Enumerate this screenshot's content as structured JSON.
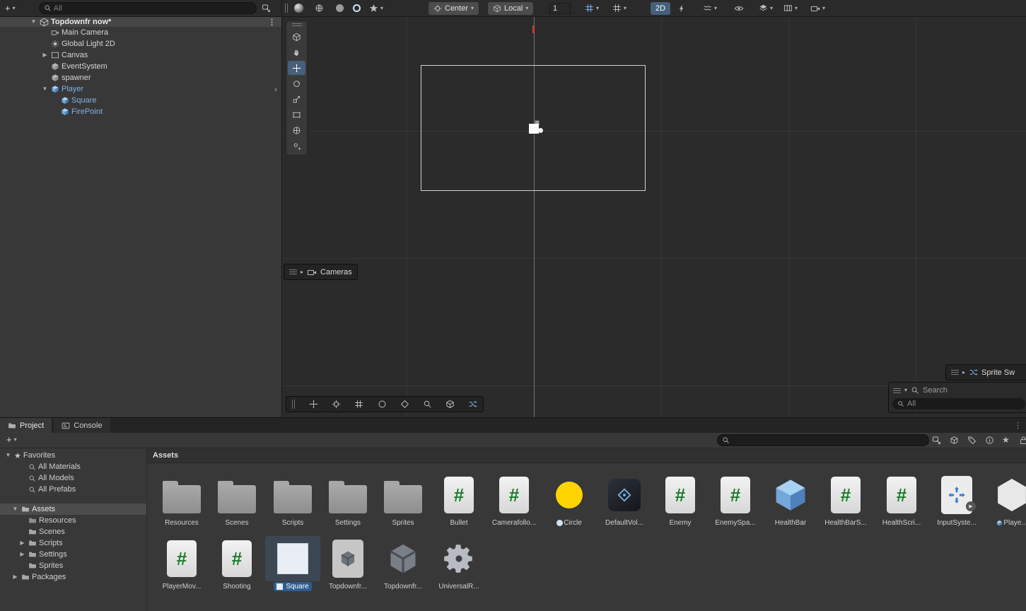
{
  "colors": {
    "selection_blue": "#2d5c8f",
    "prefab_text_blue": "#7fb2e5",
    "circle_sprite_yellow": "#ffd400",
    "active_toggle_blue": "#46607c",
    "panel_bg": "#383838",
    "scene_bg": "#2b2b2b"
  },
  "icons": {
    "caret_down": "▾",
    "foldout_open": "▼",
    "foldout_closed": "▶",
    "expand_right": "▸",
    "more_vertical": "⋮",
    "chevron_right": "›",
    "star": "★",
    "csharp_hash": "#"
  },
  "hierarchy": {
    "toolbar": {
      "add": "+",
      "search_placeholder": "All"
    },
    "scene_label": "Topdownfr now*",
    "items": [
      {
        "label": "Main Camera"
      },
      {
        "label": "Global Light 2D"
      },
      {
        "label": "Canvas"
      },
      {
        "label": "EventSystem"
      },
      {
        "label": "spawner"
      },
      {
        "label": "Player"
      },
      {
        "label": "Square"
      },
      {
        "label": "FirePoint"
      }
    ]
  },
  "scene_toolbar": {
    "center": "Center",
    "local": "Local",
    "grid_size": "1",
    "mode_2d": "2D"
  },
  "scene_view": {
    "cameras_overlay": "Cameras",
    "sprite_overlay": "Sprite Sw",
    "search_overlay": {
      "title": "Search",
      "filter": "All"
    }
  },
  "project": {
    "tabs": [
      "Project",
      "Console"
    ],
    "add": "+",
    "breadcrumb": "Assets",
    "tree": {
      "favorites": {
        "label": "Favorites",
        "children": [
          "All Materials",
          "All Models",
          "All Prefabs"
        ]
      },
      "assets": {
        "label": "Assets",
        "children": [
          "Resources",
          "Scenes",
          "Scripts",
          "Settings",
          "Sprites"
        ]
      },
      "packages": "Packages"
    },
    "assets": [
      {
        "label": "Resources",
        "type": "folder"
      },
      {
        "label": "Scenes",
        "type": "folder"
      },
      {
        "label": "Scripts",
        "type": "folder"
      },
      {
        "label": "Settings",
        "type": "folder"
      },
      {
        "label": "Sprites",
        "type": "folder"
      },
      {
        "label": "Bullet",
        "type": "csharp-script"
      },
      {
        "label": "Camerafollo...",
        "type": "csharp-script"
      },
      {
        "label": "Circle",
        "type": "sprite"
      },
      {
        "label": "DefaultVol...",
        "type": "volume-profile"
      },
      {
        "label": "Enemy",
        "type": "csharp-script"
      },
      {
        "label": "EnemySpa...",
        "type": "csharp-script"
      },
      {
        "label": "HealthBar",
        "type": "prefab"
      },
      {
        "label": "HealthBarS...",
        "type": "csharp-script"
      },
      {
        "label": "HealthScri...",
        "type": "csharp-script"
      },
      {
        "label": "InputSyste...",
        "type": "input-actions"
      },
      {
        "label": "Playe...",
        "type": "prefab"
      },
      {
        "label": "PlayerMov...",
        "type": "csharp-script"
      },
      {
        "label": "Shooting",
        "type": "csharp-script"
      },
      {
        "label": "Square",
        "type": "sprite",
        "selected": true
      },
      {
        "label": "Topdownfr...",
        "type": "scene"
      },
      {
        "label": "Topdownfr...",
        "type": "scene"
      },
      {
        "label": "UniversalR...",
        "type": "render-pipeline-asset"
      }
    ]
  }
}
